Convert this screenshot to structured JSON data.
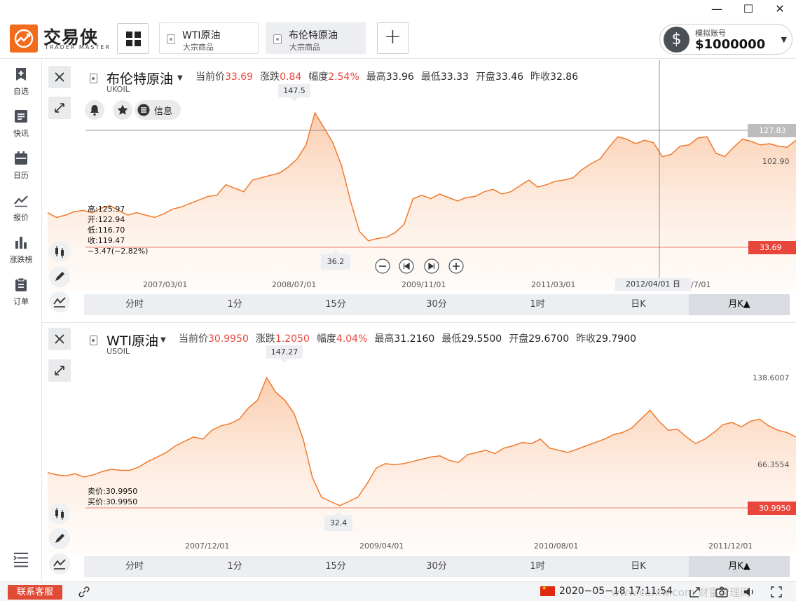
{
  "window": {
    "minimize_glyph": "—",
    "maximize_glyph": "☐",
    "close_glyph": "✕"
  },
  "app": {
    "name": "交易侠",
    "name_sub": "TRADER MASTER",
    "brand_color": "#f36b1c"
  },
  "tabs": [
    {
      "name": "WTI原油",
      "sub": "大宗商品",
      "active": false
    },
    {
      "name": "布伦特原油",
      "sub": "大宗商品",
      "active": true
    }
  ],
  "add_tab_glyph": "+",
  "account": {
    "icon_glyph": "$",
    "label": "模拟账号",
    "value": "$1000000"
  },
  "sidebar": {
    "items": [
      {
        "label": "自选",
        "icon": "bookmark-plus-icon"
      },
      {
        "label": "快讯",
        "icon": "news-icon"
      },
      {
        "label": "日历",
        "icon": "calendar-icon"
      },
      {
        "label": "报价",
        "icon": "line-chart-icon"
      },
      {
        "label": "涨跌榜",
        "icon": "bar-chart-icon"
      },
      {
        "label": "订单",
        "icon": "clipboard-icon"
      }
    ]
  },
  "panels": [
    {
      "name": "布伦特原油",
      "code": "UKOIL",
      "quote": [
        {
          "k": "当前价",
          "v": "33.69",
          "red": true
        },
        {
          "k": "涨跌",
          "v": "0.84",
          "red": true
        },
        {
          "k": "幅度",
          "v": "2.54%",
          "red": true
        },
        {
          "k": "最高",
          "v": "33.96",
          "red": false
        },
        {
          "k": "最低",
          "v": "33.33",
          "red": false
        },
        {
          "k": "开盘",
          "v": "33.46",
          "red": false
        },
        {
          "k": "昨收",
          "v": "32.86",
          "red": false
        }
      ],
      "info_label": "信息",
      "ohlc_lines": [
        "高:125.97",
        "开:122.94",
        "低:116.70",
        "收:119.47",
        "−3.47(−2.82%)"
      ],
      "peak_label": "147.5",
      "trough_label": "36.2",
      "crosshair_price": "127.83",
      "right_label": "102.90",
      "current_price": "33.69",
      "date_ticks": [
        "2007/03/01",
        "2008/07/01",
        "2009/11/01",
        "2011/03/01"
      ],
      "crosshair_date": "2012/04/01 日",
      "crosshair_date_tail": "/7/01",
      "periods": [
        "分时",
        "1分",
        "15分",
        "30分",
        "1时",
        "日K",
        "月K▲"
      ],
      "active_period": 6
    },
    {
      "name": "WTI原油",
      "code": "USOIL",
      "quote": [
        {
          "k": "当前价",
          "v": "30.9950",
          "red": true
        },
        {
          "k": "涨跌",
          "v": "1.2050",
          "red": true
        },
        {
          "k": "幅度",
          "v": "4.04%",
          "red": true
        },
        {
          "k": "最高",
          "v": "31.2160",
          "red": false
        },
        {
          "k": "最低",
          "v": "29.5500",
          "red": false
        },
        {
          "k": "开盘",
          "v": "29.6700",
          "red": false
        },
        {
          "k": "昨收",
          "v": "29.7900",
          "red": false
        }
      ],
      "bidask_lines": [
        "卖价:30.9950",
        "买价:30.9950"
      ],
      "peak_label": "147.27",
      "trough_label": "32.4",
      "right_labels": [
        "138.6007",
        "66.3554"
      ],
      "current_price": "30.9950",
      "date_ticks": [
        "2007/12/01",
        "2009/04/01",
        "2010/08/01",
        "2011/12/01"
      ],
      "periods": [
        "分时",
        "1分",
        "15分",
        "30分",
        "1时",
        "日K",
        "月K▲"
      ],
      "active_period": 6
    }
  ],
  "chart_data": [
    {
      "type": "area",
      "title": "布伦特原油 UKOIL",
      "x": [
        "2006/09",
        "2006/10",
        "2006/11",
        "2006/12",
        "2007/01",
        "2007/02",
        "2007/03",
        "2007/04",
        "2007/05",
        "2007/06",
        "2007/07",
        "2007/08",
        "2007/09",
        "2007/10",
        "2007/11",
        "2007/12",
        "2008/01",
        "2008/02",
        "2008/03",
        "2008/04",
        "2008/05",
        "2008/06",
        "2008/07",
        "2008/08",
        "2008/09",
        "2008/10",
        "2008/11",
        "2008/12",
        "2009/01",
        "2009/02",
        "2009/03",
        "2009/04",
        "2009/05",
        "2009/06",
        "2009/07",
        "2009/08",
        "2009/09",
        "2009/10",
        "2009/11",
        "2009/12",
        "2010/01",
        "2010/02",
        "2010/03",
        "2010/04",
        "2010/05",
        "2010/06",
        "2010/07",
        "2010/08",
        "2010/09",
        "2010/10",
        "2010/11",
        "2010/12",
        "2011/01",
        "2011/02",
        "2011/03",
        "2011/04",
        "2011/05",
        "2011/06",
        "2011/07",
        "2011/08",
        "2011/09",
        "2011/10",
        "2011/11",
        "2011/12",
        "2012/01",
        "2012/02",
        "2012/03",
        "2012/04",
        "2012/05",
        "2012/06",
        "2012/07",
        "2012/08",
        "2012/09",
        "2012/10",
        "2012/11",
        "2012/12",
        "2013/01",
        "2013/02",
        "2013/03",
        "2013/04",
        "2013/05",
        "2013/06",
        "2013/07",
        "2013/08",
        "2013/09"
      ],
      "values": [
        62,
        58,
        60,
        63,
        64,
        62,
        66,
        68,
        64,
        60,
        62,
        60,
        58,
        61,
        65,
        67,
        70,
        73,
        76,
        77,
        86,
        83,
        80,
        90,
        92,
        94,
        96,
        101,
        108,
        120,
        147.5,
        135,
        122,
        102,
        72,
        46,
        38,
        40,
        41,
        45,
        52,
        74,
        77,
        74,
        78,
        75,
        72,
        75,
        76,
        80,
        82,
        78,
        80,
        85,
        90,
        84,
        86,
        89,
        90,
        92,
        99,
        104,
        108,
        118,
        127,
        125,
        121,
        124,
        122,
        110,
        112,
        119,
        120,
        126,
        127,
        113,
        110,
        118,
        125,
        123,
        120,
        121,
        119,
        118,
        124
      ],
      "xlabel": "",
      "ylabel": "",
      "ylim": [
        0,
        160
      ],
      "markers": {
        "high": 147.5,
        "low": 36.2,
        "crosshair": 127.83,
        "current": 33.69
      },
      "grid": false
    },
    {
      "type": "area",
      "title": "WTI原油 USOIL",
      "x": [
        "2006/09",
        "2006/10",
        "2006/11",
        "2006/12",
        "2007/01",
        "2007/02",
        "2007/03",
        "2007/04",
        "2007/05",
        "2007/06",
        "2007/07",
        "2007/08",
        "2007/09",
        "2007/10",
        "2007/11",
        "2007/12",
        "2008/01",
        "2008/02",
        "2008/03",
        "2008/04",
        "2008/05",
        "2008/06",
        "2008/07",
        "2008/08",
        "2008/09",
        "2008/10",
        "2008/11",
        "2008/12",
        "2009/01",
        "2009/02",
        "2009/03",
        "2009/04",
        "2009/05",
        "2009/06",
        "2009/07",
        "2009/08",
        "2009/09",
        "2009/10",
        "2009/11",
        "2009/12",
        "2010/01",
        "2010/02",
        "2010/03",
        "2010/04",
        "2010/05",
        "2010/06",
        "2010/07",
        "2010/08",
        "2010/09",
        "2010/10",
        "2010/11",
        "2010/12",
        "2011/01",
        "2011/02",
        "2011/03",
        "2011/04",
        "2011/05",
        "2011/06",
        "2011/07",
        "2011/08",
        "2011/09",
        "2011/10",
        "2011/11",
        "2011/12",
        "2012/01",
        "2012/02",
        "2012/03",
        "2012/04",
        "2012/05",
        "2012/06",
        "2012/07",
        "2012/08",
        "2012/09",
        "2012/10",
        "2012/11",
        "2012/12",
        "2013/01",
        "2013/02",
        "2013/03",
        "2013/04",
        "2013/05",
        "2013/06",
        "2013/07"
      ],
      "values": [
        62,
        60,
        59,
        61,
        58,
        60,
        63,
        65,
        64,
        64,
        67,
        72,
        76,
        80,
        86,
        90,
        94,
        92,
        100,
        104,
        106,
        110,
        120,
        127,
        147.27,
        134,
        127,
        115,
        92,
        58,
        40,
        36,
        32.4,
        36,
        40,
        52,
        66,
        70,
        69,
        70,
        72,
        74,
        76,
        77,
        73,
        71,
        78,
        80,
        82,
        79,
        84,
        86,
        89,
        88,
        92,
        84,
        82,
        80,
        83,
        86,
        89,
        92,
        96,
        98,
        102,
        110,
        118,
        108,
        100,
        101,
        94,
        88,
        92,
        98,
        105,
        107,
        103,
        108,
        110,
        104,
        100,
        98,
        94
      ],
      "xlabel": "",
      "ylabel": "",
      "ylim": [
        0,
        160
      ],
      "markers": {
        "high": 147.27,
        "low": 32.4,
        "current": 30.995
      },
      "grid": false
    }
  ],
  "status": {
    "support_label": "联系客服",
    "clock": "2020−05−18 17:11:54",
    "watermark": "www.cafxw.com 财富管理网"
  },
  "colors": {
    "accent": "#f36b1c",
    "line": "#ef7a2c",
    "red": "#e8463b"
  }
}
